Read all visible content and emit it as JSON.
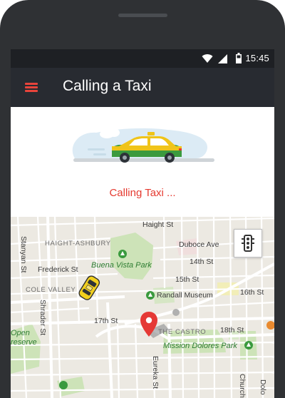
{
  "status_bar": {
    "time": "15:45",
    "icons": [
      "wifi-icon",
      "cellular-signal-icon",
      "battery-icon"
    ]
  },
  "app_bar": {
    "title": "Calling a Taxi",
    "menu_icon": "hamburger-menu-icon",
    "accent_color": "#e8443b",
    "background": "#282b31"
  },
  "calling": {
    "illustration": "taxi-car-illustration",
    "message": "Calling Taxi ...",
    "message_color": "#e53a30"
  },
  "map": {
    "traffic_button_icon": "traffic-light-icon",
    "labels": {
      "haight_st": "Haight St",
      "haight_ashbury": "HAIGHT-ASHBURY",
      "duboce_ave": "Duboce Ave",
      "fourteenth_st": "14th St",
      "stanyan_st": "Stanyan St",
      "frederick_st": "Frederick St",
      "buena_vista_park": "Buena Vista Park",
      "fifteenth_st": "15th St",
      "cole_valley": "COLE VALLEY",
      "randall_museum": "Randall Museum",
      "sixteenth_st": "16th St",
      "shrader_st": "Shrader St",
      "seventeenth_st": "17th St",
      "the_castro": "THE CASTRO",
      "eighteenth_st": "18th St",
      "open": "Open",
      "preserve": "reserve",
      "mission_dolores_park": "Mission Dolores Park",
      "eureka_st": "Eureka St",
      "church": "Church",
      "dolo": "Dolo"
    }
  }
}
